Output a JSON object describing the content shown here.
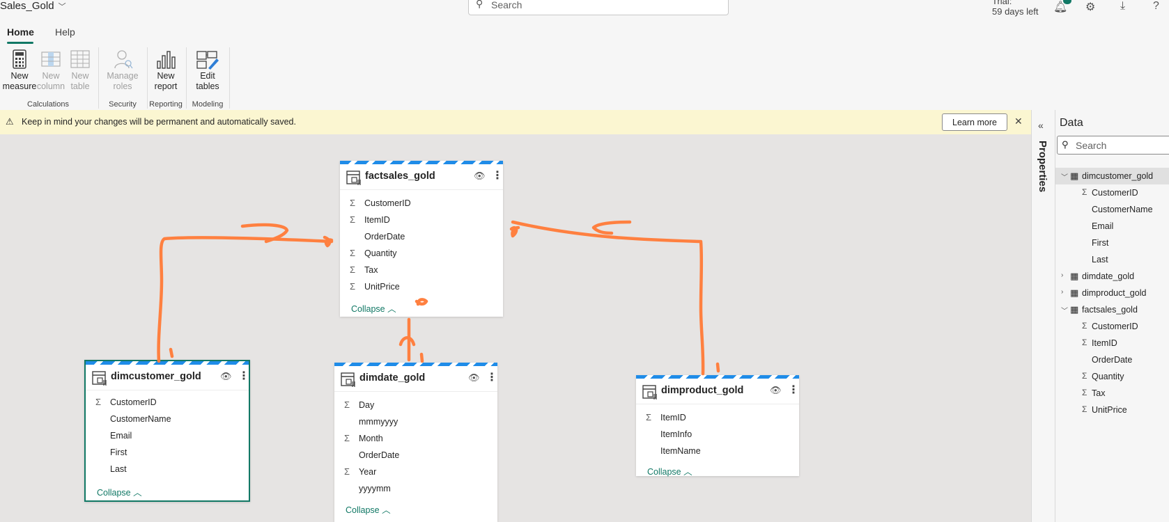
{
  "app": {
    "title": "Sales_Gold"
  },
  "top_search": {
    "placeholder": "Search"
  },
  "trial": {
    "line1": "Trial:",
    "line2": "59 days left"
  },
  "tabs": [
    {
      "label": "Home"
    },
    {
      "label": "Help"
    }
  ],
  "ribbon": {
    "new_measure": "New measure",
    "new_column": "New column",
    "new_table": "New table",
    "manage_roles": "Manage roles",
    "new_report": "New report",
    "edit_tables": "Edit tables",
    "groups": [
      "Calculations",
      "Security",
      "Reporting",
      "Modeling"
    ]
  },
  "banner": {
    "text": "Keep in mind your changes will be permanent and automatically saved.",
    "learn_more": "Learn more"
  },
  "properties": {
    "label": "Properties"
  },
  "data_pane": {
    "title": "Data",
    "search_placeholder": "Search",
    "tree": [
      {
        "label": "dimcustomer_gold",
        "expanded": true,
        "fields": [
          {
            "name": "CustomerID",
            "sigma": true
          },
          {
            "name": "CustomerName",
            "sigma": false
          },
          {
            "name": "Email",
            "sigma": false
          },
          {
            "name": "First",
            "sigma": false
          },
          {
            "name": "Last",
            "sigma": false
          }
        ]
      },
      {
        "label": "dimdate_gold",
        "expanded": false,
        "fields": []
      },
      {
        "label": "dimproduct_gold",
        "expanded": false,
        "fields": []
      },
      {
        "label": "factsales_gold",
        "expanded": true,
        "fields": [
          {
            "name": "CustomerID",
            "sigma": true
          },
          {
            "name": "ItemID",
            "sigma": true
          },
          {
            "name": "OrderDate",
            "sigma": false
          },
          {
            "name": "Quantity",
            "sigma": true
          },
          {
            "name": "Tax",
            "sigma": true
          },
          {
            "name": "UnitPrice",
            "sigma": true
          }
        ]
      }
    ]
  },
  "cards": {
    "factsales": {
      "name": "factsales_gold",
      "collapse": "Collapse",
      "fields": [
        {
          "name": "CustomerID",
          "sigma": "Σ"
        },
        {
          "name": "ItemID",
          "sigma": "Σ"
        },
        {
          "name": "OrderDate",
          "sigma": ""
        },
        {
          "name": "Quantity",
          "sigma": "Σ"
        },
        {
          "name": "Tax",
          "sigma": "Σ"
        },
        {
          "name": "UnitPrice",
          "sigma": "Σ"
        }
      ]
    },
    "dimcustomer": {
      "name": "dimcustomer_gold",
      "collapse": "Collapse",
      "fields": [
        {
          "name": "CustomerID",
          "sigma": "Σ"
        },
        {
          "name": "CustomerName",
          "sigma": ""
        },
        {
          "name": "Email",
          "sigma": ""
        },
        {
          "name": "First",
          "sigma": ""
        },
        {
          "name": "Last",
          "sigma": ""
        }
      ]
    },
    "dimdate": {
      "name": "dimdate_gold",
      "collapse": "Collapse",
      "fields": [
        {
          "name": "Day",
          "sigma": "Σ"
        },
        {
          "name": "mmmyyyy",
          "sigma": ""
        },
        {
          "name": "Month",
          "sigma": "Σ"
        },
        {
          "name": "OrderDate",
          "sigma": ""
        },
        {
          "name": "Year",
          "sigma": "Σ"
        },
        {
          "name": "yyyymm",
          "sigma": ""
        }
      ]
    },
    "dimproduct": {
      "name": "dimproduct_gold",
      "collapse": "Collapse",
      "fields": [
        {
          "name": "ItemID",
          "sigma": "Σ"
        },
        {
          "name": "ItemInfo",
          "sigma": ""
        },
        {
          "name": "ItemName",
          "sigma": ""
        }
      ]
    }
  },
  "icons": {
    "search": "search-icon",
    "warning": "warning-icon",
    "close": "close-icon",
    "eye": "eye-icon",
    "more": "more-icon",
    "table": "table-icon"
  },
  "colors": {
    "accent": "#117865",
    "stripe": "#1f8ce8",
    "annotation": "#ff8040",
    "banner": "#fbf6d1"
  }
}
